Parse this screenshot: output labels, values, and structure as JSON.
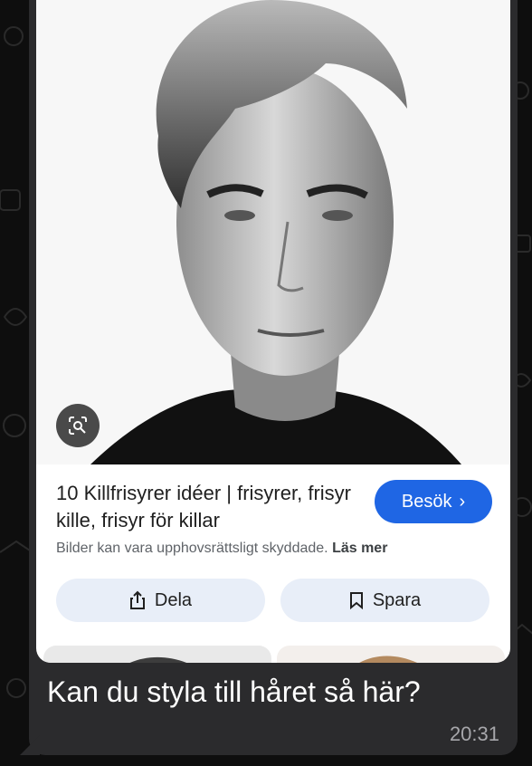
{
  "card": {
    "title": "10 Killfrisyrer idéer | frisyrer, frisyr kille, frisyr för killar",
    "visit_label": "Besök",
    "copyright_text": "Bilder kan vara upphovsrättsligt skyddade.",
    "read_more_label": "Läs mer",
    "share_label": "Dela",
    "save_label": "Spara"
  },
  "message": {
    "text": "Kan du styla till håret så här?",
    "time": "20:31"
  },
  "colors": {
    "bubble": "#2b2b2d",
    "accent": "#1f66e4",
    "button_bg": "#e8eef8"
  }
}
